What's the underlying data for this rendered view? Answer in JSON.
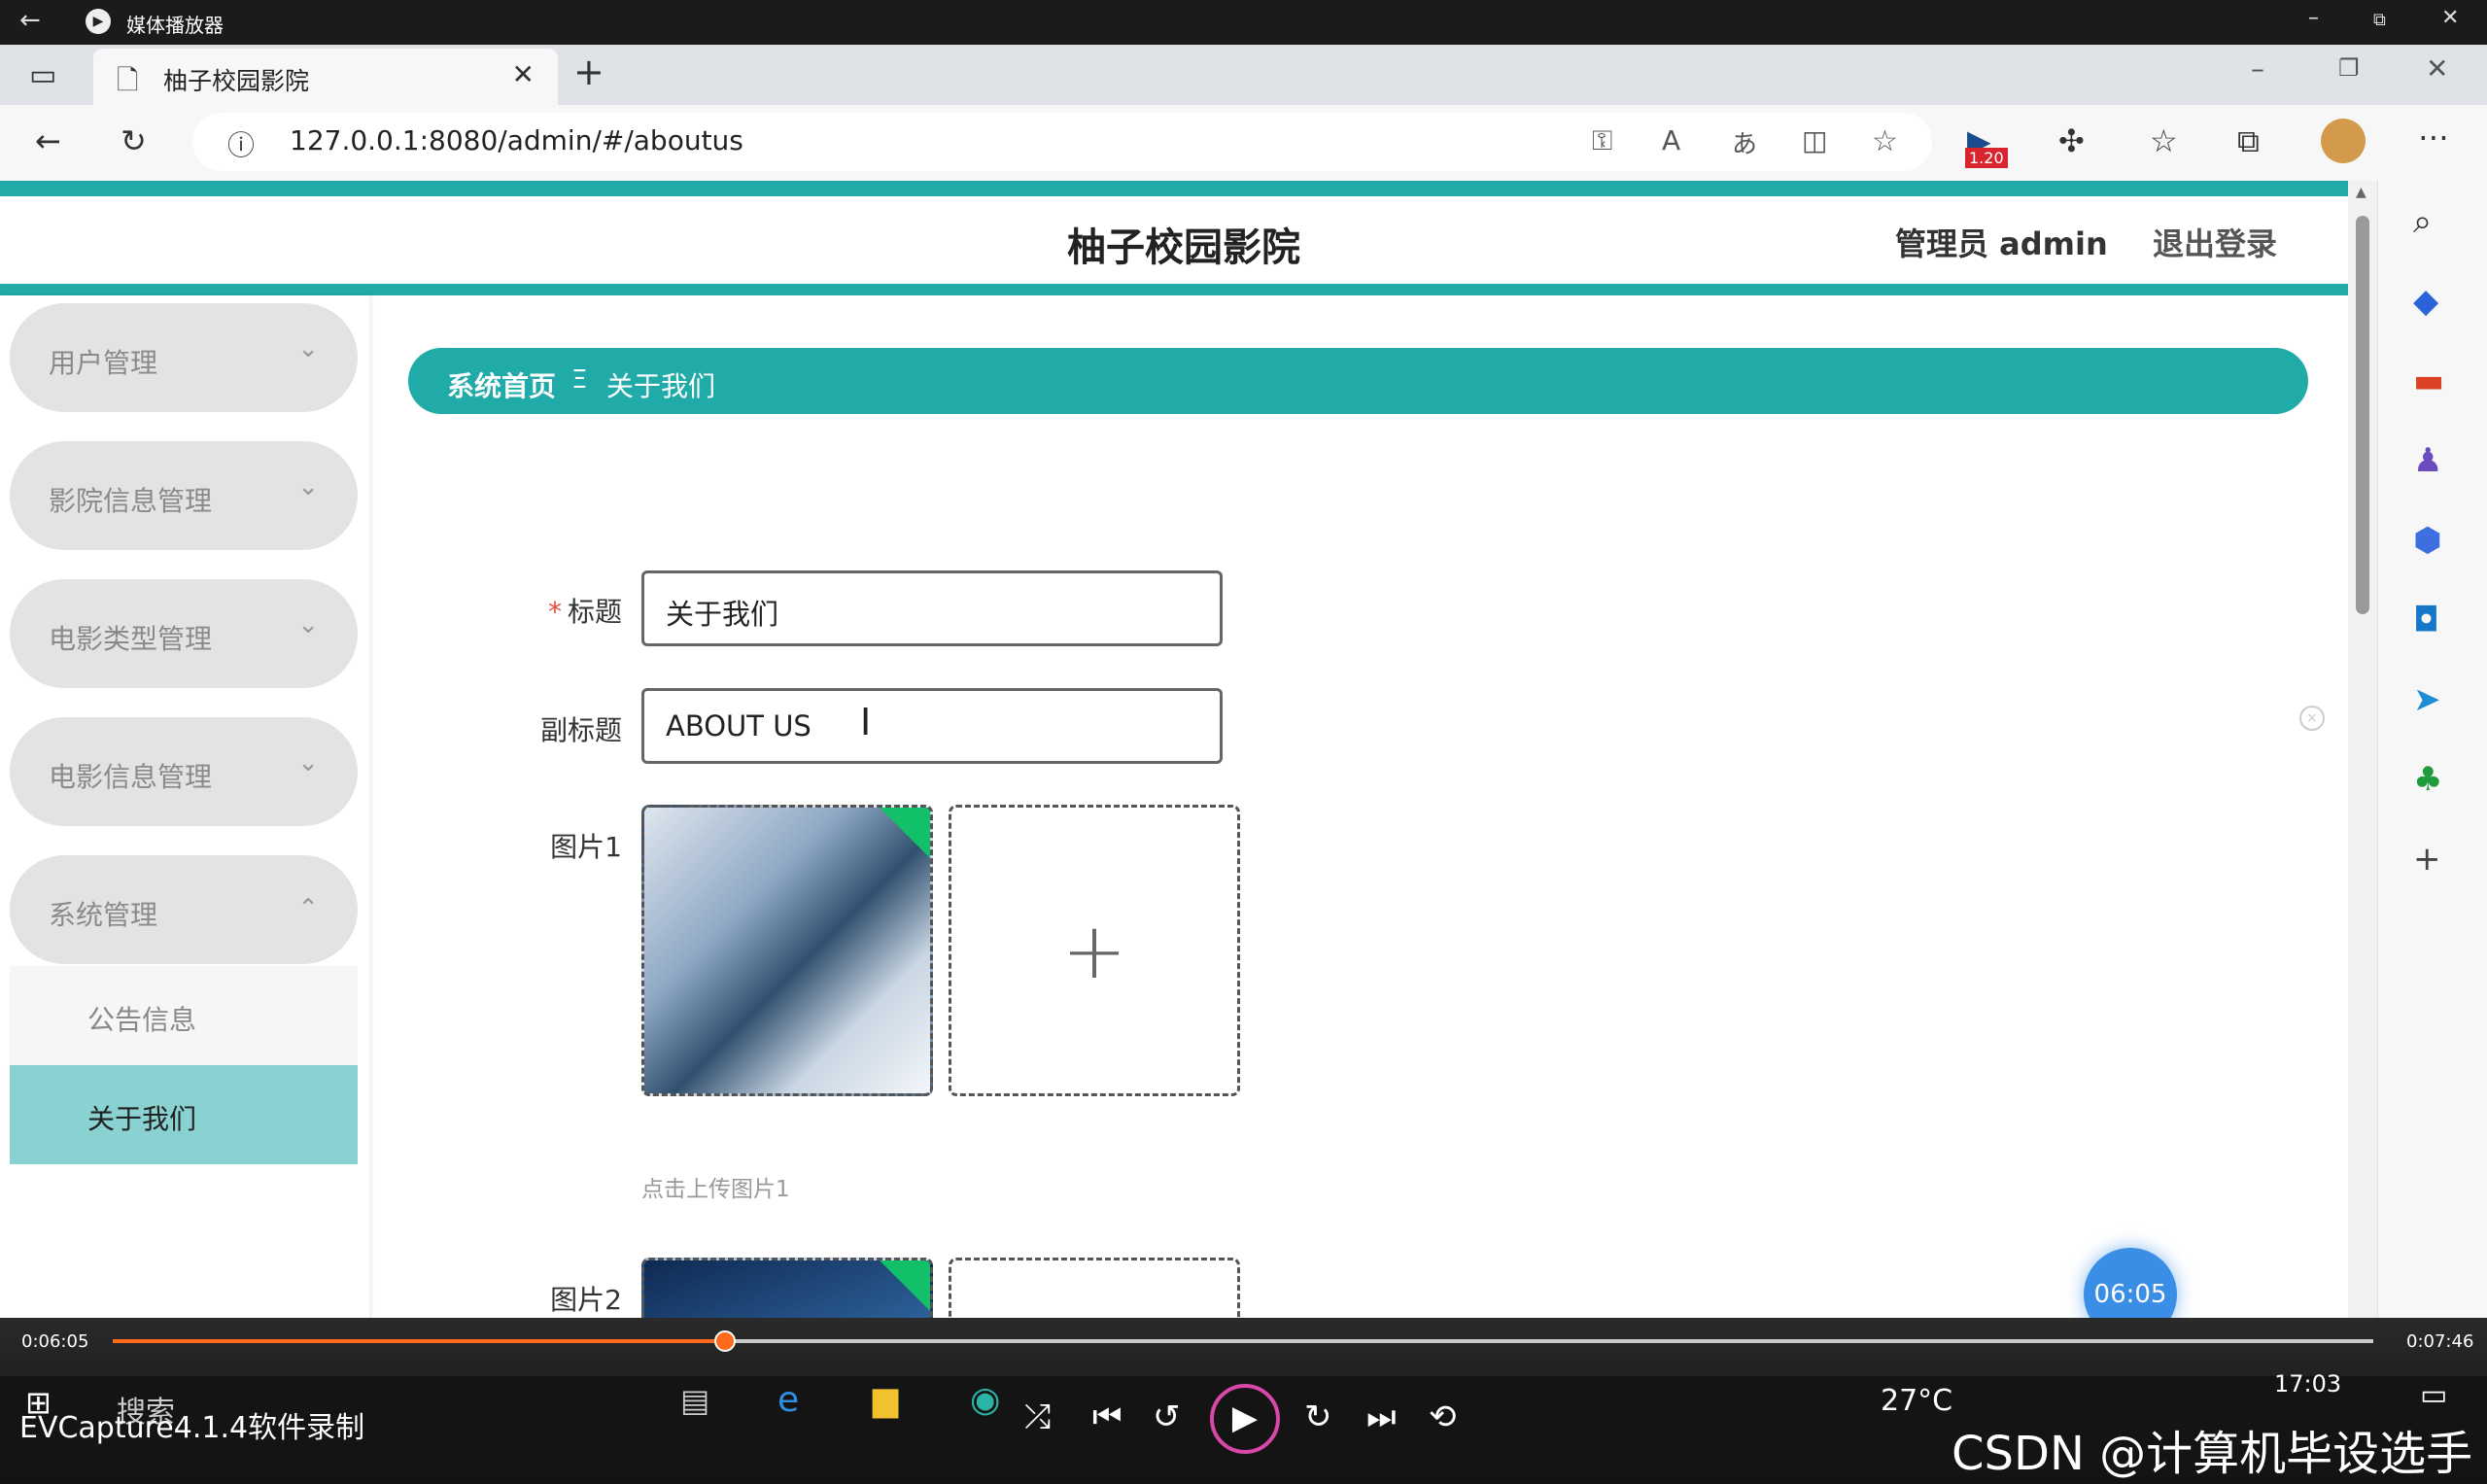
{
  "player": {
    "title": "媒体播放器"
  },
  "browser": {
    "tab_title": "柚子校园影院",
    "url": "127.0.0.1:8080/admin/#/aboutus",
    "badge_value": "1.20"
  },
  "site": {
    "title": "柚子校园影院",
    "admin_label": "管理员 admin",
    "logout_label": "退出登录"
  },
  "sidebar": {
    "items": [
      {
        "label": "用户管理"
      },
      {
        "label": "影院信息管理"
      },
      {
        "label": "电影类型管理"
      },
      {
        "label": "电影信息管理"
      },
      {
        "label": "系统管理"
      }
    ],
    "subitems": [
      {
        "label": "公告信息"
      },
      {
        "label": "关于我们"
      }
    ]
  },
  "breadcrumb": {
    "home": "系统首页",
    "separator": "Ξ",
    "current": "关于我们"
  },
  "form": {
    "title_label": "标题",
    "title_value": "关于我们",
    "subtitle_label": "副标题",
    "subtitle_value": "ABOUT US",
    "pic1_label": "图片1",
    "pic1_hint": "点击上传图片1",
    "pic2_label": "图片2"
  },
  "video": {
    "badge_time": "06:05",
    "current_time": "0:06:05",
    "total_time": "0:07:46",
    "progress_fraction": 0.271
  },
  "taskbar": {
    "recorder_text": "EVCapture4.1.4软件录制",
    "search_text": "搜索",
    "weather": "27°C",
    "clock": "17:03",
    "watermark": "CSDN @计算机毕设选手"
  }
}
